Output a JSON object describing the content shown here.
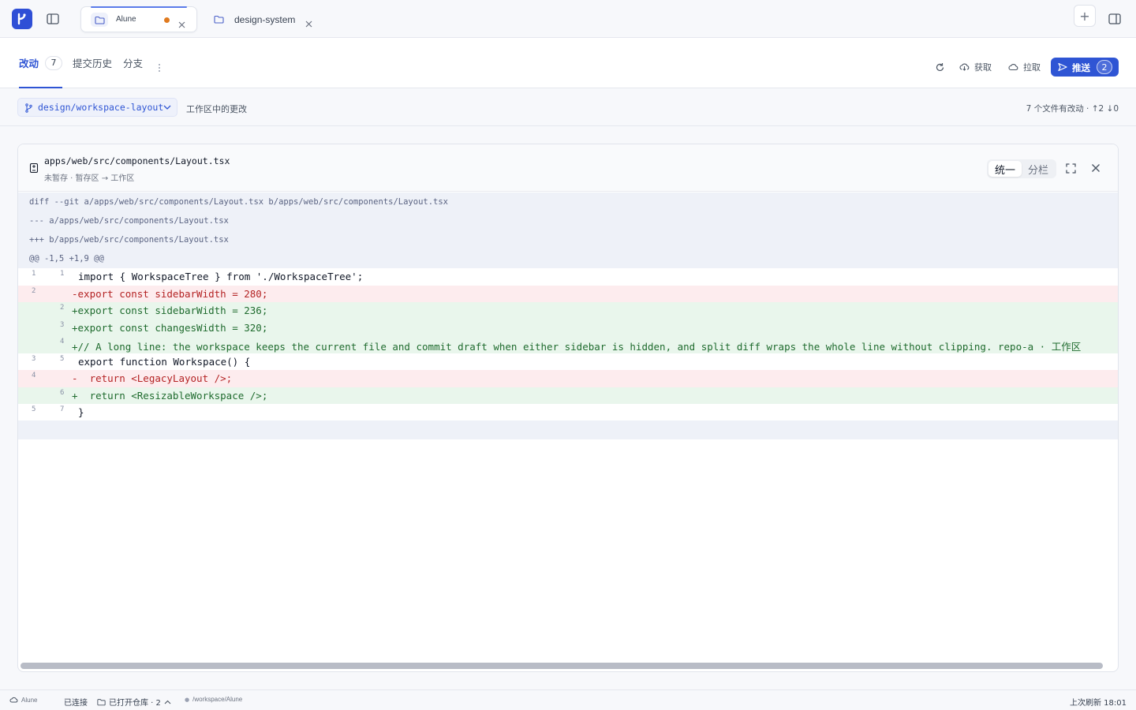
{
  "titlebar": {
    "tabs": [
      {
        "label": "Alune",
        "modified": true,
        "active": true
      },
      {
        "label": "design-system",
        "modified": false,
        "active": false
      }
    ],
    "new_tab_label": "+"
  },
  "toolbar": {
    "tabs": [
      {
        "label": "改动",
        "count": "7"
      },
      {
        "label": "提交历史"
      },
      {
        "label": "分支"
      }
    ],
    "fetch_label": "获取",
    "pull_label": "拉取",
    "push_label": "推送",
    "push_count": "2"
  },
  "branch_bar": {
    "branch": "design/workspace-layout",
    "scope_label": "工作区中的更改",
    "summary": "7 个文件有改动 · ↑2 ↓0"
  },
  "diff": {
    "file_path": "apps/web/src/components/Layout.tsx",
    "file_state": "未暂存 · 暂存区 → 工作区",
    "view_modes": [
      "统一",
      "分栏"
    ],
    "active_view": "统一",
    "meta": [
      "diff --git a/apps/web/src/components/Layout.tsx b/apps/web/src/components/Layout.tsx",
      "--- a/apps/web/src/components/Layout.tsx",
      "+++ b/apps/web/src/components/Layout.tsx",
      "@@ -1,5 +1,9 @@"
    ],
    "lines": [
      {
        "type": "ctx",
        "old": "1",
        "new": "1",
        "text": "import { WorkspaceTree } from './WorkspaceTree';"
      },
      {
        "type": "del",
        "old": "2",
        "new": "",
        "text": "-export const sidebarWidth = 280;"
      },
      {
        "type": "add",
        "old": "",
        "new": "2",
        "text": "+export const sidebarWidth = 236;"
      },
      {
        "type": "add",
        "old": "",
        "new": "3",
        "text": "+export const changesWidth = 320;"
      },
      {
        "type": "add",
        "old": "",
        "new": "4",
        "text": "+// A long line: the workspace keeps the current file and commit draft when either sidebar is hidden, and split diff wraps the whole line without clipping. repo-a · 工作区"
      },
      {
        "type": "ctx",
        "old": "3",
        "new": "5",
        "text": "export function Workspace() {"
      },
      {
        "type": "del",
        "old": "4",
        "new": "",
        "text": "-  return <LegacyLayout />;"
      },
      {
        "type": "add",
        "old": "",
        "new": "6",
        "text": "+  return <ResizableWorkspace />;"
      },
      {
        "type": "ctx",
        "old": "5",
        "new": "7",
        "text": "}"
      }
    ]
  },
  "statusbar": {
    "repo": "Alune",
    "connection": "已连接",
    "open_repos": "已打开仓库 · 2",
    "path": "/workspace/Alune",
    "last_refresh": "上次刷新 18:01"
  },
  "colors": {
    "accent": "#2f55d4",
    "deleted_bg": "#fdecee",
    "added_bg": "#e9f6ec",
    "modified_dot": "#e07a1f"
  }
}
